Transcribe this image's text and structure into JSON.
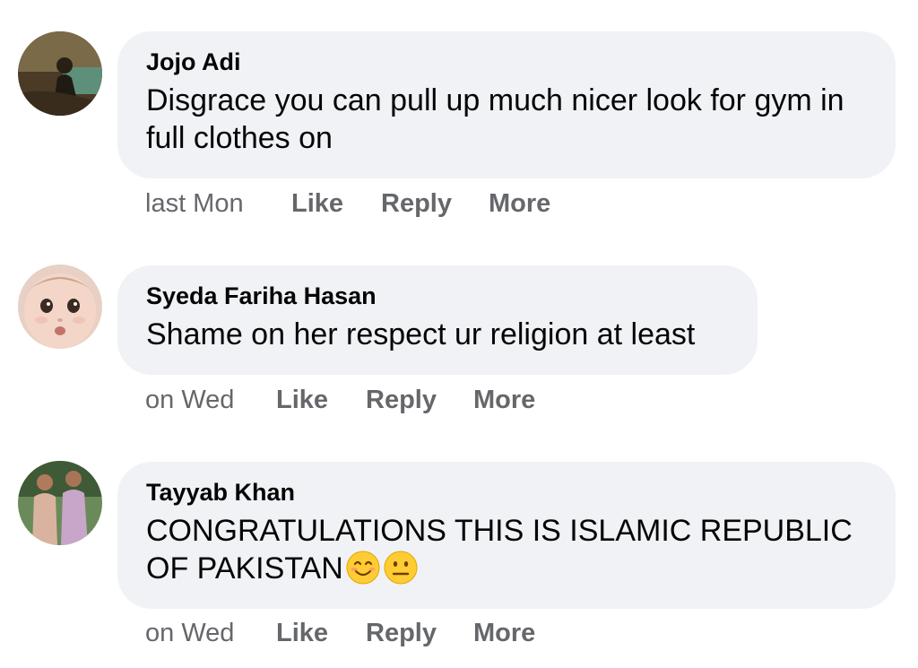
{
  "comments": [
    {
      "author": "Jojo Adi",
      "text": "Disgrace you can pull up much nicer look for gym in full clothes on",
      "time": "last Mon",
      "like": "Like",
      "reply": "Reply",
      "more": "More"
    },
    {
      "author": "Syeda Fariha Hasan",
      "text": "Shame on her respect ur religion at least",
      "time": "on Wed",
      "like": "Like",
      "reply": "Reply",
      "more": "More"
    },
    {
      "author": "Tayyab Khan",
      "text": "CONGRATULATIONS THIS IS ISLAMIC REPUBLIC OF PAKISTAN",
      "emojis": [
        "smiling-face-icon",
        "neutral-face-icon"
      ],
      "time": "on Wed",
      "like": "Like",
      "reply": "Reply",
      "more": "More"
    }
  ],
  "colors": {
    "bubble": "#f0f2f5",
    "meta_text": "#65676b",
    "primary_text": "#050505"
  }
}
